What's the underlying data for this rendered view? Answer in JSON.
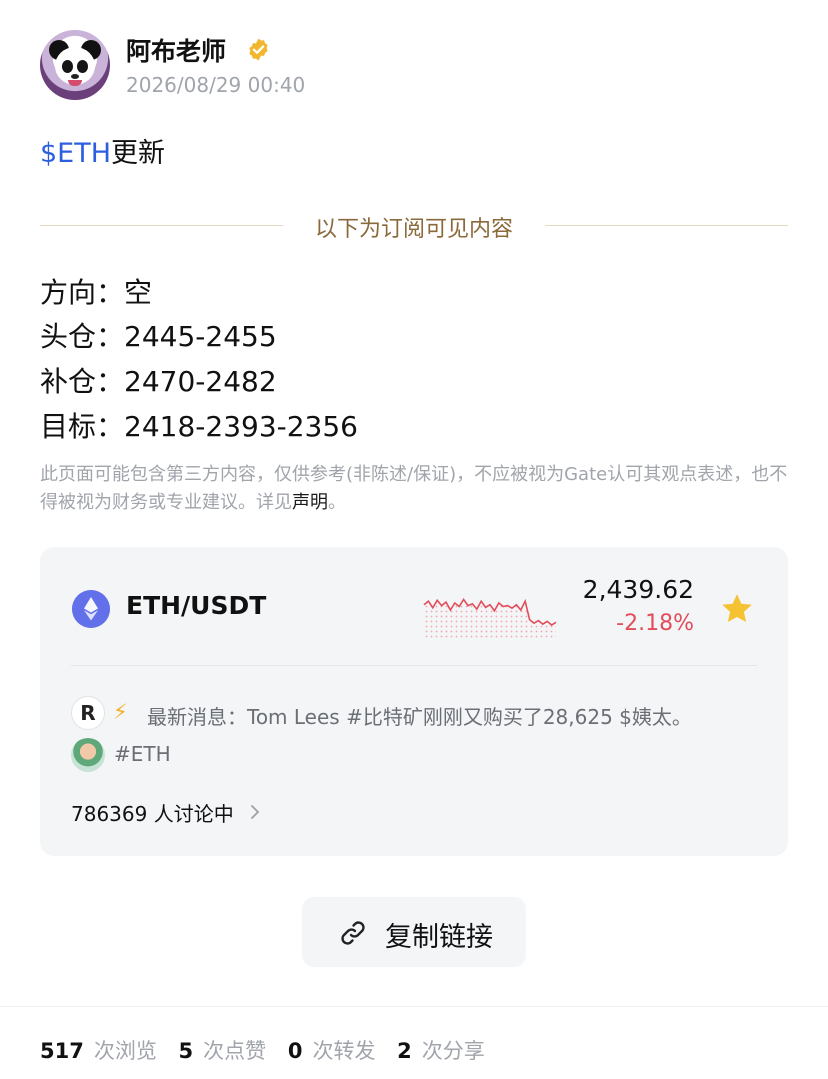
{
  "author": {
    "name": "阿布老师",
    "time": "2026/08/29 00:40"
  },
  "post": {
    "ticker": "$ETH",
    "title_suffix": "更新",
    "subscriber_divider": "以下为订阅可见内容",
    "signals": [
      {
        "label": "方向：",
        "value": "空"
      },
      {
        "label": "头仓：",
        "value": "2445-2455"
      },
      {
        "label": "补仓：",
        "value": "2470-2482"
      },
      {
        "label": "目标：",
        "value": "2418-2393-2356"
      }
    ],
    "disclaimer_text": "此页面可能包含第三方内容，仅供参考(非陈述/保证)，不应被视为Gate认可其观点表述，也不得被视为财务或专业建议。详见",
    "disclaimer_link": "声明",
    "disclaimer_end": "。"
  },
  "market_card": {
    "pair": "ETH/USDT",
    "price": "2,439.62",
    "change": "-2.18%",
    "sparkline_trend": [
      0.62,
      0.7,
      0.55,
      0.72,
      0.6,
      0.68,
      0.5,
      0.66,
      0.58,
      0.74,
      0.6,
      0.64,
      0.52,
      0.7,
      0.56,
      0.62,
      0.48,
      0.66,
      0.58,
      0.6,
      0.54,
      0.62,
      0.5,
      0.7,
      0.28,
      0.2,
      0.26,
      0.18,
      0.24,
      0.16,
      0.22
    ],
    "news_logo_letter": "R",
    "news_prefix": "最新消息：",
    "news_text": "Tom Lees #比特矿刚刚又购买了28,625 $姨太。",
    "topic_tag": "#ETH",
    "discussion": "786369 人讨论中",
    "colors": {
      "down": "#e24d5a",
      "favorite": "#f5c232"
    }
  },
  "actions": {
    "copy_link": "复制链接"
  },
  "stats": [
    {
      "count": "517",
      "label": "次浏览"
    },
    {
      "count": "5",
      "label": "次点赞"
    },
    {
      "count": "0",
      "label": "次转发"
    },
    {
      "count": "2",
      "label": "次分享"
    }
  ]
}
